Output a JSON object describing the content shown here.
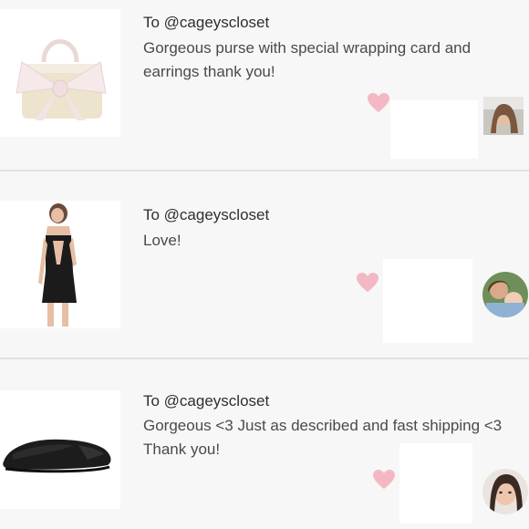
{
  "reviews": [
    {
      "to": "To @cageyscloset",
      "message": "Gorgeous purse with special wrapping card and earrings thank you!",
      "item": "purse-with-bow",
      "heart_color": "#f4b8c4"
    },
    {
      "to": "To @cageyscloset",
      "message": "Love!",
      "item": "black-cutout-dress",
      "heart_color": "#f4b8c4"
    },
    {
      "to": "To @cageyscloset",
      "message": "Gorgeous <3 Just as described and fast shipping <3 Thank you!",
      "item": "black-flat-shoe",
      "heart_color": "#f4b8c4"
    }
  ]
}
